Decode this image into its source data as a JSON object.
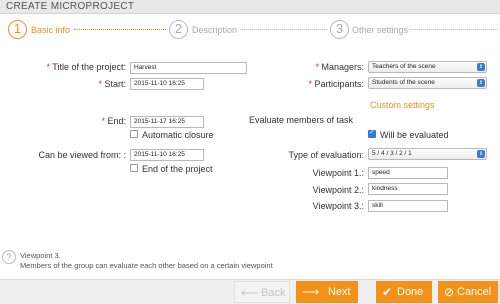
{
  "window": {
    "title": "CREATE MICROPROJECT"
  },
  "wizard": {
    "steps": [
      {
        "num": "1",
        "label": "Basic info"
      },
      {
        "num": "2",
        "label": "Description"
      },
      {
        "num": "3",
        "label": "Other settings"
      }
    ]
  },
  "form": {
    "title_label": "Title of the project:",
    "title_value": "Harvest",
    "start_label": "Start:",
    "start_value": "2015-11-10 16:25",
    "end_label": "End:",
    "end_value": "2015-11-17 16:25",
    "automatic_closure_label": "Automatic closure",
    "viewed_from_label": "Can be viewed from: :",
    "viewed_from_value": "2015-11-10 16:25",
    "end_of_project_label": "End of the project",
    "managers_label": "Managers:",
    "managers_value": "Teachers of the scene",
    "participants_label": "Participants:",
    "participants_value": "Students of the scene",
    "custom_settings_label": "Custom settings",
    "evaluate_heading": "Evaluate members of task",
    "will_be_evaluated_label": "Will be evaluated",
    "type_of_evaluation_label": "Type of evaluation:",
    "type_of_evaluation_value": "5 / 4 / 3 / 2 / 1",
    "viewpoint1_label": "Viewpoint 1.:",
    "viewpoint1_value": "speed",
    "viewpoint2_label": "Viewpoint 2.:",
    "viewpoint2_value": "kindness",
    "viewpoint3_label": "Viewpoint 3.:",
    "viewpoint3_value": "skill",
    "required_mark": "*"
  },
  "help": {
    "icon": "?",
    "title": "Viewpoint 3.",
    "text": "Members of the group can evaluate each other based on a certain viewpoint"
  },
  "footer": {
    "back_label": "Back",
    "next_label": "Next",
    "done_label": "Done",
    "cancel_label": "Cancel"
  },
  "colors": {
    "accent": "#f39219",
    "required": "#e0302a",
    "select_arrow": "#3a7bd5",
    "checkbox_on": "#2f7ae5"
  },
  "icons": {
    "back": "arrow-left-icon",
    "next": "arrow-right-icon",
    "done": "check-icon",
    "cancel": "cancel-icon",
    "help": "question-icon"
  }
}
